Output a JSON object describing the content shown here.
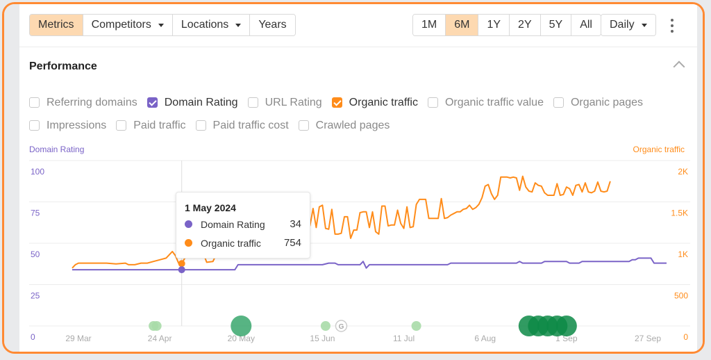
{
  "toolbar": {
    "tabs": [
      {
        "label": "Metrics",
        "active": true
      },
      {
        "label": "Competitors",
        "dropdown": true
      },
      {
        "label": "Locations",
        "dropdown": true
      },
      {
        "label": "Years"
      }
    ],
    "ranges": [
      {
        "label": "1M"
      },
      {
        "label": "6M",
        "active": true
      },
      {
        "label": "1Y"
      },
      {
        "label": "2Y"
      },
      {
        "label": "5Y"
      },
      {
        "label": "All"
      }
    ],
    "interval": "Daily",
    "more_icon": "kebab-menu-icon"
  },
  "panel": {
    "title": "Performance",
    "collapse_icon": "chevron-up-icon",
    "metrics_row1": [
      {
        "label": "Referring domains",
        "checked": false
      },
      {
        "label": "Domain Rating",
        "checked": true,
        "color": "#7a63c7"
      },
      {
        "label": "URL Rating",
        "checked": false
      },
      {
        "label": "Organic traffic",
        "checked": true,
        "color": "#ff8c1a"
      },
      {
        "label": "Organic traffic value",
        "checked": false
      },
      {
        "label": "Organic pages",
        "checked": false
      }
    ],
    "metrics_row2": [
      {
        "label": "Impressions",
        "checked": false
      },
      {
        "label": "Paid traffic",
        "checked": false
      },
      {
        "label": "Paid traffic cost",
        "checked": false
      },
      {
        "label": "Crawled pages",
        "checked": false
      }
    ]
  },
  "tooltip": {
    "date": "1 May 2024",
    "rows": [
      {
        "label": "Domain Rating",
        "value": "34",
        "color": "#7a63c7"
      },
      {
        "label": "Organic traffic",
        "value": "754",
        "color": "#ff8c1a"
      }
    ]
  },
  "chart_data": {
    "type": "line",
    "title": "Performance",
    "ylabel_left": "Domain Rating",
    "ylabel_right": "Organic traffic",
    "ylim_left": [
      0,
      100
    ],
    "ylim_right": [
      0,
      2000
    ],
    "yticks_left": [
      "0",
      "25",
      "50",
      "75",
      "100"
    ],
    "yticks_right": [
      "0",
      "500",
      "1K",
      "1.5K",
      "2K"
    ],
    "xticks": [
      "29 Mar",
      "24 Apr",
      "20 May",
      "15 Jun",
      "11 Jul",
      "6 Aug",
      "1 Sep",
      "27 Sep"
    ],
    "x_range_days": [
      0,
      182
    ],
    "grid": true,
    "series": [
      {
        "name": "Domain Rating",
        "axis": "left",
        "color": "#7a63c7",
        "points": [
          [
            -2,
            34
          ],
          [
            66,
            34
          ],
          [
            67,
            37
          ],
          [
            98,
            37
          ],
          [
            100,
            38
          ],
          [
            103,
            38
          ],
          [
            104,
            37
          ],
          [
            113,
            37
          ],
          [
            114,
            39
          ],
          [
            115,
            36
          ],
          [
            116,
            37
          ],
          [
            130,
            37
          ],
          [
            131,
            38
          ],
          [
            153,
            38
          ],
          [
            155,
            39
          ],
          [
            158,
            39
          ],
          [
            159,
            38
          ],
          [
            174,
            38
          ],
          [
            175,
            37
          ],
          [
            176,
            37
          ],
          [
            177,
            37
          ],
          [
            178,
            37
          ],
          [
            180,
            37
          ],
          [
            184,
            37
          ],
          [
            186,
            37
          ],
          [
            190,
            37
          ],
          [
            192,
            37
          ],
          [
            194,
            37
          ],
          [
            195,
            37
          ],
          [
            196,
            37
          ],
          [
            197,
            37
          ],
          [
            160,
            38
          ],
          [
            166,
            38
          ],
          [
            167,
            37
          ],
          [
            170,
            37
          ],
          [
            171,
            38
          ],
          [
            172,
            38
          ],
          [
            173,
            38
          ]
        ]
      },
      {
        "name": "Organic traffic",
        "axis": "right",
        "color": "#ff8c1a",
        "points": []
      }
    ],
    "events": [
      {
        "x_day": 24,
        "size": "small",
        "color": "#a8dba8"
      },
      {
        "x_day": 25,
        "size": "small",
        "color": "#a8dba8"
      },
      {
        "x_day": 52,
        "size": "large",
        "color": "#3aa76d"
      },
      {
        "x_day": 79,
        "size": "small",
        "color": "#a8dba8"
      },
      {
        "x_day": 84,
        "type": "google-update",
        "label": "G"
      },
      {
        "x_day": 108,
        "size": "small",
        "color": "#a8dba8"
      },
      {
        "x_day": 144,
        "size": "large",
        "color": "#0d8a46"
      },
      {
        "x_day": 147,
        "size": "large",
        "color": "#0d8a46"
      },
      {
        "x_day": 150,
        "size": "large",
        "color": "#0d8a46"
      },
      {
        "x_day": 153,
        "size": "large",
        "color": "#0d8a46"
      },
      {
        "x_day": 156,
        "size": "large",
        "color": "#0d8a46"
      }
    ],
    "hover": {
      "x_day": 33,
      "date": "1 May 2024",
      "domain_rating": 34,
      "organic_traffic": 754
    }
  }
}
